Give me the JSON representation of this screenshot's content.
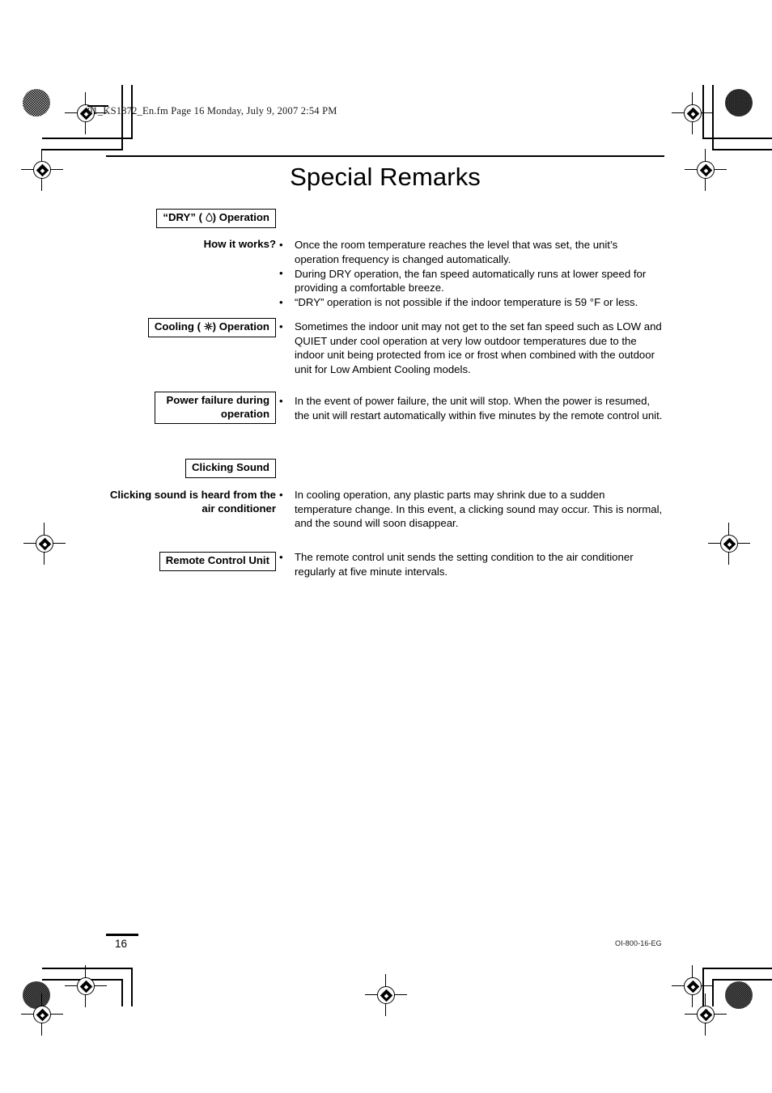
{
  "file_header": {
    "text": "01_KS1872_En.fm  Page 16  Monday, July 9, 2007  2:54 PM"
  },
  "page_title": "Special Remarks",
  "sections": [
    {
      "label": "“DRY” (  ) Operation",
      "label_prefix": "“DRY” (",
      "label_suffix": ") Operation",
      "icon": "water-drop-icon",
      "sub_label": "How it works?",
      "bullets": [
        "Once the room temperature reaches the level that was set, the unit’s operation frequency is changed automatically.",
        "During DRY operation, the fan speed automatically runs at lower speed for providing a comfortable breeze.",
        "“DRY” operation is not possible if the indoor temperature is 59 °F or less."
      ]
    },
    {
      "label": "Cooling (  ) Operation",
      "label_prefix": "Cooling (",
      "label_suffix": ") Operation",
      "icon": "snowflake-icon",
      "sub_label": "",
      "bullets": [
        "Sometimes the indoor unit may not get to the set fan speed such as LOW and QUIET under cool operation at very low outdoor temperatures due to the indoor unit being protected from ice or frost when combined with the outdoor unit for Low Ambient Cooling models."
      ]
    },
    {
      "label": "Power failure during operation",
      "sub_label": "",
      "bullets": [
        "In the event of power failure, the unit will stop. When the power is resumed, the unit will restart automatically within five minutes by the remote control unit."
      ]
    },
    {
      "label": "Clicking Sound",
      "sub_label": "Clicking sound is heard from the air conditioner",
      "bullets": [
        "In cooling operation, any plastic parts may shrink due to a sudden temperature change. In this event, a clicking sound may occur. This is normal, and the sound will soon disappear."
      ]
    },
    {
      "label": "Remote Control Unit",
      "sub_label": "",
      "bullets": [
        "The remote control unit sends the setting condition to the air conditioner regularly at five minute intervals."
      ]
    }
  ],
  "footer": {
    "page_number": "16",
    "doc_code": "OI-800-16-EG"
  },
  "bullet_glyph": "•",
  "colors": {
    "text": "#000000",
    "background": "#ffffff",
    "rule": "#000000"
  }
}
